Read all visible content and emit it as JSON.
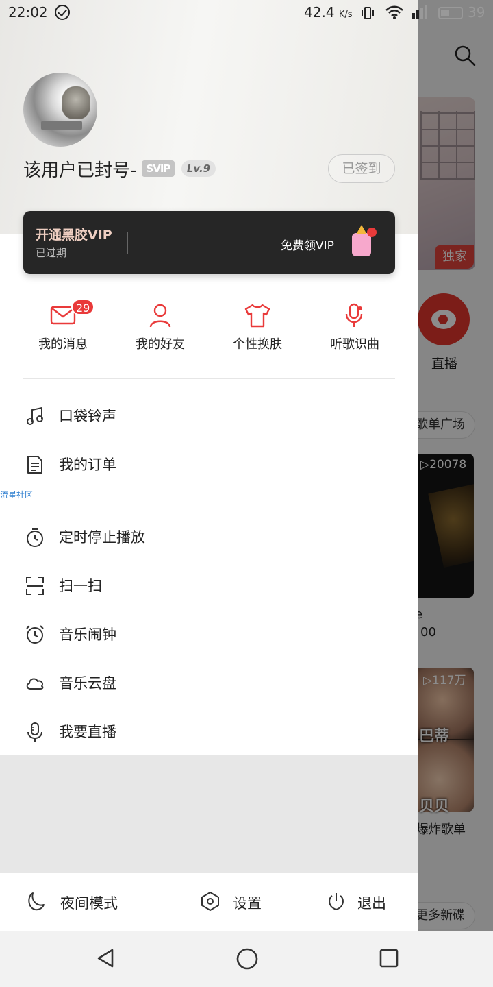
{
  "status_bar": {
    "time": "22:02",
    "speed": "42.4",
    "speed_unit": "K/s",
    "battery": "39"
  },
  "background": {
    "exclusive_tag": "独家",
    "live_label": "直播",
    "playlist_square": "歌单广场",
    "card1_plays": "▷20078",
    "card1_text1": "e",
    "card1_text2": "00",
    "card2_plays": "▷117万",
    "card2_label1": "巴蒂",
    "card2_label2": "贝贝",
    "card2_caption": "爆炸歌单",
    "more_albums": "更多新碟"
  },
  "profile": {
    "username": "该用户已封号-",
    "svip_badge": "SVIP",
    "level": "Lv.9",
    "signed_label": "已签到"
  },
  "vip": {
    "title": "开通黑胶VIP",
    "subtitle": "已过期",
    "free_label": "免费领VIP"
  },
  "quick": {
    "messages": "我的消息",
    "friends": "我的好友",
    "skin": "个性换肤",
    "recognize": "听歌识曲",
    "msg_count": "29"
  },
  "menu1": {
    "ringtone": "口袋铃声",
    "orders": "我的订单"
  },
  "watermark": "流星社区",
  "menu2": {
    "timer": "定时停止播放",
    "scan": "扫一扫",
    "alarm": "音乐闹钟",
    "cloud": "音乐云盘",
    "live": "我要直播"
  },
  "bottom": {
    "night": "夜间模式",
    "settings": "设置",
    "logout": "退出"
  },
  "colors": {
    "accent": "#e93a3a",
    "vip_card": "#262626",
    "vip_title": "#efcfc2"
  }
}
